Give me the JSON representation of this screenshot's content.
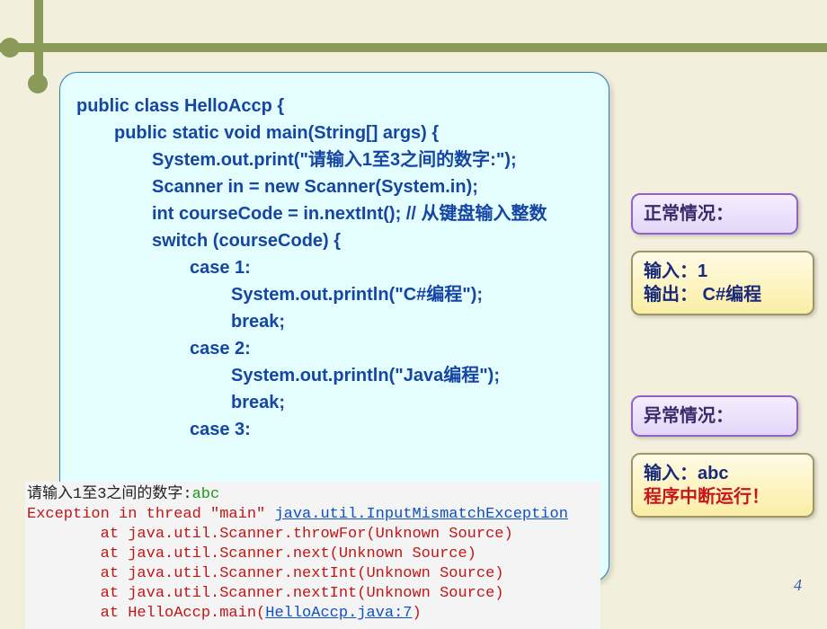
{
  "code": {
    "l01": "public class HelloAccp {",
    "l02": "public static void main(String[] args) {",
    "l03": "System.out.print(\"请输入1至3之间的数字:\");",
    "l04": "Scanner in = new Scanner(System.in);",
    "l05": "int courseCode = in.nextInt(); // 从键盘输入整数",
    "l06": "switch (courseCode) {",
    "l07": "case 1:",
    "l08": "System.out.println(\"C#编程\");",
    "l09": "break;",
    "l10": "case 2:",
    "l11": "System.out.println(\"Java编程\");",
    "l12": "break;",
    "l13": "case 3:"
  },
  "callouts": {
    "normal_header": "正常情况：",
    "normal_in_label": "输入：",
    "normal_in_value": "1",
    "normal_out_label": "输出：",
    "normal_out_value": " C#编程",
    "error_header": "异常情况：",
    "error_in_label": "输入：",
    "error_in_value": "abc",
    "error_result": "程序中断运行！"
  },
  "console": {
    "prompt": "请输入1至3之间的数字:",
    "input": "abc",
    "exc_prefix": "Exception in thread \"main\" ",
    "exc_link": "java.util.InputMismatchException",
    "t1": "        at java.util.Scanner.throwFor(Unknown Source)",
    "t2": "        at java.util.Scanner.next(Unknown Source)",
    "t3": "        at java.util.Scanner.nextInt(Unknown Source)",
    "t4": "        at java.util.Scanner.nextInt(Unknown Source)",
    "t5_prefix": "        at HelloAccp.main(",
    "t5_link": "HelloAccp.java:7",
    "t5_suffix": ")"
  },
  "page_number": "4"
}
